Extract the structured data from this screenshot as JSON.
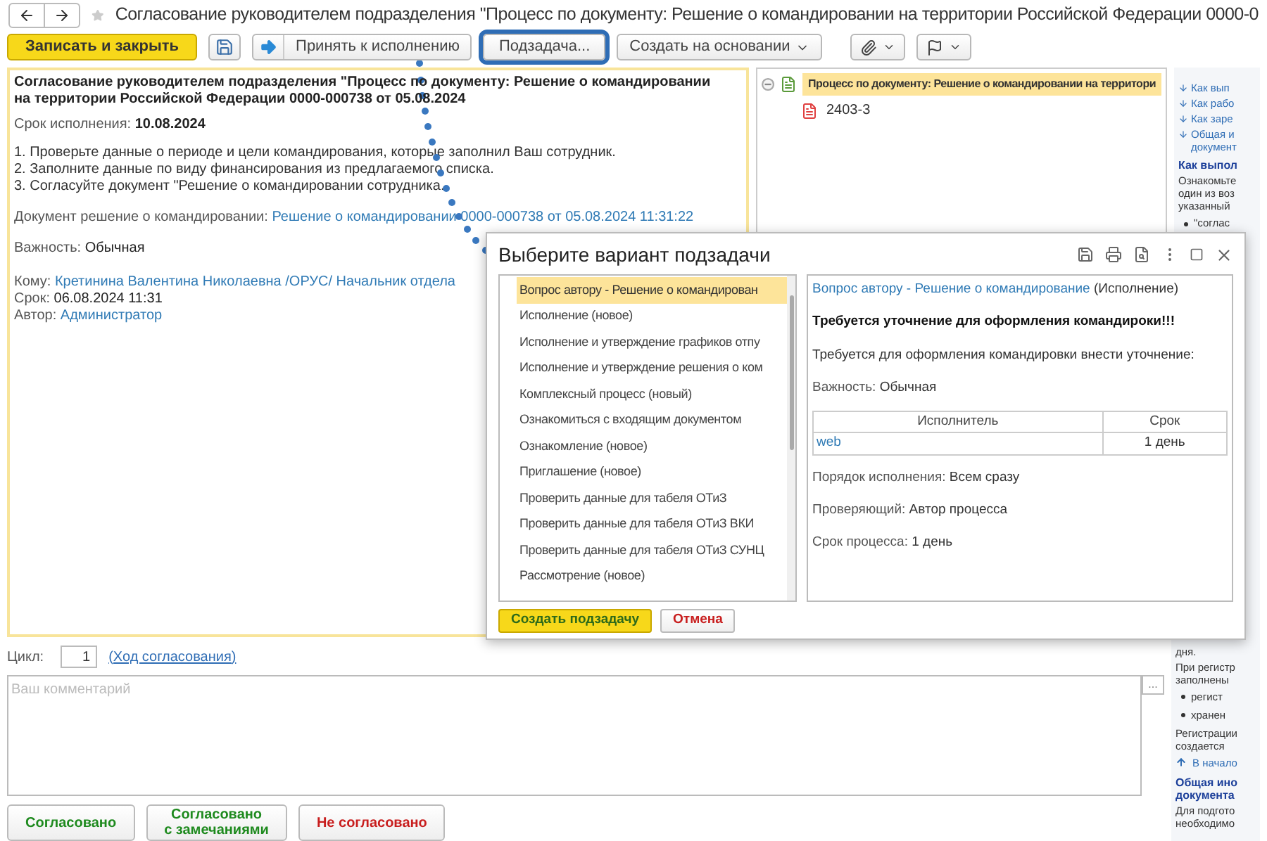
{
  "window": {
    "title": "Согласование руководителем подразделения \"Процесс по документу: Решение о командировании на территории Российской Федерации 0000-0"
  },
  "toolbar": [
    {
      "kind": "primary",
      "label": "Записать и закрыть",
      "highlighted": false
    },
    {
      "kind": "save",
      "highlighted": false
    },
    {
      "kind": "accept",
      "label": "Принять к исполнению",
      "highlighted": false
    },
    {
      "kind": "plain",
      "label": "Подзадача...",
      "highlighted": true
    },
    {
      "kind": "dropdown",
      "label": "Создать на основании",
      "highlighted": false
    },
    {
      "kind": "attach",
      "highlighted": false
    },
    {
      "kind": "flag",
      "highlighted": false
    }
  ],
  "task": {
    "heading": "Согласование руководителем подразделения \"Процесс по документу: Решение о командировании на территории Российской Федерации 0000-000738 от 05.08.2024",
    "deadline_label": "Срок исполнения:",
    "deadline_value": "10.08.2024",
    "steps": [
      "1. Проверьте данные о периоде и цели командирования, которые заполнил Ваш сотрудник.",
      "2. Заполните данные по виду финансирования из предлагаемого списка.",
      "3. Согласуйте документ \"Решение о командировании сотрудника."
    ],
    "document": {
      "label": "Документ решение о командировании:",
      "value": "Решение о командировании 0000-000738 от 05.08.2024 11:31:22"
    },
    "importance": {
      "label": "Важность:",
      "value": "Обычная"
    },
    "fields": [
      {
        "label": "Кому:",
        "value": "Кретинина Валентина Николаевна /ОРУС/ Начальник отдела",
        "kind": "link"
      },
      {
        "label": "Срок:",
        "value": "06.08.2024 11:31",
        "kind": "text"
      },
      {
        "label": "Автор:",
        "value": "Администратор",
        "kind": "link"
      }
    ]
  },
  "tree": {
    "label": "Процесс по документу: Решение о командировании на территори",
    "selected": true,
    "expanded": true,
    "children": [
      {
        "label": "2403-3"
      }
    ]
  },
  "help_top": [
    {
      "kind": "link",
      "text": "Как вып"
    },
    {
      "kind": "link",
      "text": "Как рабо"
    },
    {
      "kind": "link",
      "text": "Как заре"
    },
    {
      "kind": "link",
      "text": "Общая и\nдокумент"
    },
    {
      "kind": "heading",
      "text": "Как выпол"
    },
    {
      "kind": "para",
      "text": "Ознакомьте\nодин из воз\nуказанный"
    },
    {
      "kind": "bullet",
      "text": "\"соглас"
    }
  ],
  "help_bottom": [
    {
      "kind": "para",
      "text": "дня."
    },
    {
      "kind": "para",
      "text": "При регистр\nзаполнены"
    },
    {
      "kind": "bullet",
      "text": "регист"
    },
    {
      "kind": "bullet",
      "text": "хранен"
    },
    {
      "kind": "para",
      "text": "Регистрации\nсоздается"
    },
    {
      "kind": "up",
      "text": "В начало"
    },
    {
      "kind": "heading",
      "text": "Общая ино\nдокумента"
    },
    {
      "kind": "para",
      "text": "Для подгото\nнеобходимо"
    }
  ],
  "cycle": {
    "label": "Цикл:",
    "value": "1",
    "link": "(Ход согласования)"
  },
  "comment": {
    "placeholder": "Ваш комментарий",
    "button": "..."
  },
  "actions": [
    {
      "label": "Согласовано",
      "color": "#1e8a1e"
    },
    {
      "label": "Согласовано\nс замечаниями",
      "color": "#1e8a1e"
    },
    {
      "label": "Не согласовано",
      "color": "#c81e1e"
    }
  ],
  "dialog": {
    "title": "Выберите вариант подзадачи",
    "variants": [
      {
        "label": "Вопрос автору - Решение о командирован",
        "selected": true
      },
      {
        "label": "Исполнение (новое)",
        "selected": false
      },
      {
        "label": "Исполнение и утверждение графиков отпу",
        "selected": false
      },
      {
        "label": "Исполнение и утверждение решения о ком",
        "selected": false
      },
      {
        "label": "Комплексный процесс (новый)",
        "selected": false
      },
      {
        "label": "Ознакомиться с входящим документом",
        "selected": false
      },
      {
        "label": "Ознакомление (новое)",
        "selected": false
      },
      {
        "label": "Приглашение (новое)",
        "selected": false
      },
      {
        "label": "Проверить данные для табеля ОТиЗ",
        "selected": false
      },
      {
        "label": "Проверить данные для табеля ОТиЗ ВКИ",
        "selected": false
      },
      {
        "label": "Проверить данные для табеля ОТиЗ СУНЦ",
        "selected": false
      },
      {
        "label": "Рассмотрение (новое)",
        "selected": false
      }
    ],
    "detail": {
      "link": "Вопрос автору - Решение о командирование",
      "status": "(Исполнение)",
      "heading": "Требуется уточнение для оформления командироки!!!",
      "text": "Требуется для оформления командировки внести уточнение:",
      "importance_label": "Важность:",
      "importance_value": "Обычная",
      "columns": [
        "Исполнитель",
        "Срок"
      ],
      "rows": [
        [
          "web",
          "1 день"
        ]
      ],
      "fields": [
        {
          "label": "Порядок исполнения:",
          "value": "Всем сразу"
        },
        {
          "label": "Проверяющий:",
          "value": "Автор процесса"
        },
        {
          "label": "Срок процесса:",
          "value": "1 день"
        }
      ]
    },
    "buttons": [
      {
        "kind": "primary",
        "label": "Создать подзадачу"
      },
      {
        "kind": "cancel",
        "label": "Отмена"
      }
    ]
  }
}
